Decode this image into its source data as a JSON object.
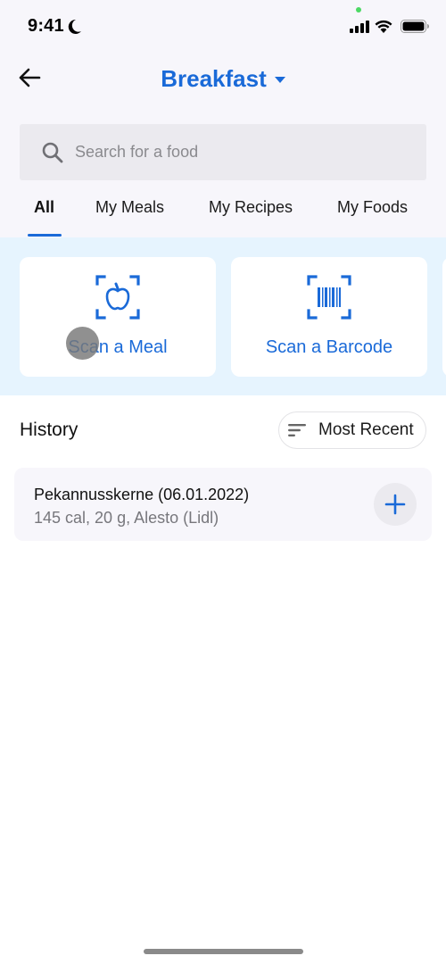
{
  "status_bar": {
    "time": "9:41",
    "icons": [
      "moon-icon",
      "signal-icon",
      "wifi-icon",
      "battery-icon"
    ]
  },
  "header": {
    "back_icon": "arrow-left-icon",
    "title": "Breakfast",
    "title_dropdown_icon": "caret-down-icon"
  },
  "search": {
    "placeholder": "Search for a food",
    "value": "",
    "icon": "search-icon"
  },
  "tabs": [
    {
      "label": "All",
      "active": true
    },
    {
      "label": "My Meals",
      "active": false
    },
    {
      "label": "My Recipes",
      "active": false
    },
    {
      "label": "My Foods",
      "active": false
    }
  ],
  "scan_options": [
    {
      "label": "Scan a Meal",
      "icon": "scan-apple-icon"
    },
    {
      "label": "Scan a Barcode",
      "icon": "scan-barcode-icon"
    }
  ],
  "history": {
    "title": "History",
    "sort": {
      "label": "Most Recent",
      "icon": "sort-icon"
    },
    "items": [
      {
        "name": "Pekannusskerne (06.01.2022)",
        "details": "145 cal, 20 g, Alesto (Lidl)",
        "action_icon": "plus-icon"
      }
    ]
  },
  "colors": {
    "accent": "#1a6ad8",
    "scan_background": "#e6f4fe",
    "page_background": "#f7f6fb"
  }
}
